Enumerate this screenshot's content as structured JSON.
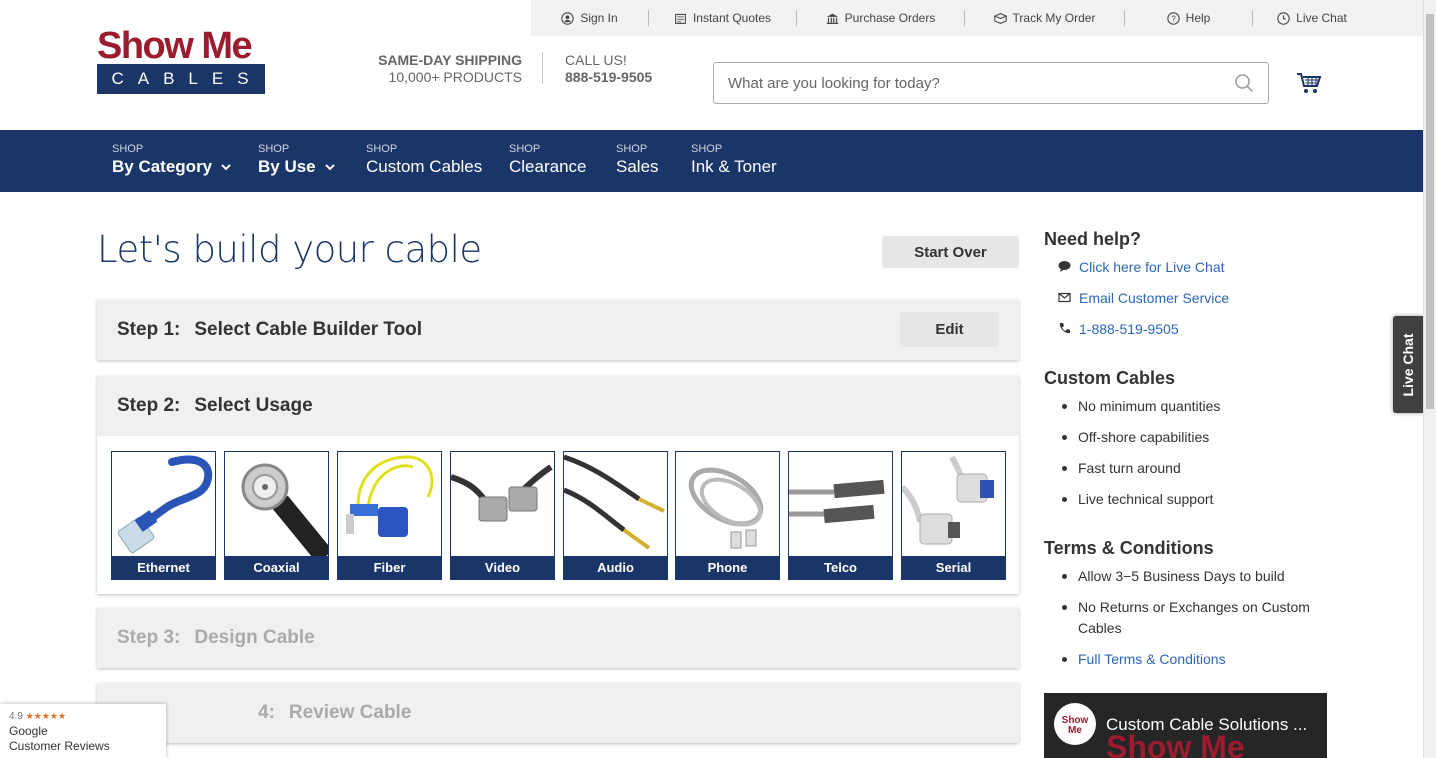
{
  "topbar": {
    "items": [
      {
        "label": "Sign In",
        "icon": "user-icon"
      },
      {
        "label": "Instant Quotes",
        "icon": "quote-icon"
      },
      {
        "label": "Purchase Orders",
        "icon": "bank-icon"
      },
      {
        "label": "Track My Order",
        "icon": "box-icon"
      },
      {
        "label": "Help",
        "icon": "help-icon"
      },
      {
        "label": "Live Chat",
        "icon": "clock-icon"
      }
    ]
  },
  "logo": {
    "line1": "Show Me",
    "line2": "CABLES"
  },
  "header": {
    "ship_bold": "SAME-DAY SHIPPING",
    "ship_sub": "10,000+ PRODUCTS",
    "call_label": "CALL US!",
    "call_number": "888-519-9505"
  },
  "search": {
    "placeholder": "What are you looking for today?"
  },
  "nav": {
    "items": [
      {
        "pre": "SHOP",
        "label": "By Category"
      },
      {
        "pre": "SHOP",
        "label": "By Use"
      },
      {
        "pre": "SHOP",
        "label": "Custom Cables"
      },
      {
        "pre": "SHOP",
        "label": "Clearance"
      },
      {
        "pre": "SHOP",
        "label": "Sales"
      },
      {
        "pre": "SHOP",
        "label": "Ink & Toner"
      }
    ]
  },
  "main": {
    "title": "Let's build your cable",
    "start_over": "Start Over",
    "steps": [
      {
        "num": "Step 1:",
        "label": "Select Cable Builder Tool",
        "action": "Edit"
      },
      {
        "num": "Step 2:",
        "label": "Select Usage"
      },
      {
        "num": "Step 3:",
        "label": "Design Cable"
      },
      {
        "num": "4:",
        "label": "Review Cable"
      }
    ],
    "usage_tiles": [
      "Ethernet",
      "Coaxial",
      "Fiber",
      "Video",
      "Audio",
      "Phone",
      "Telco",
      "Serial"
    ]
  },
  "sidebar": {
    "help_title": "Need help?",
    "help_links": [
      {
        "label": "Click here for Live Chat",
        "icon": "chat-icon"
      },
      {
        "label": "Email Customer Service",
        "icon": "mail-icon"
      },
      {
        "label": "1-888-519-9505",
        "icon": "phone-icon"
      }
    ],
    "custom_title": "Custom Cables",
    "custom_items": [
      "No minimum quantities",
      "Off-shore capabilities",
      "Fast turn around",
      "Live technical support"
    ],
    "terms_title": "Terms & Conditions",
    "terms_items": [
      "Allow 3−5 Business Days to build",
      "No Returns or Exchanges on Custom Cables"
    ],
    "terms_link": "Full Terms & Conditions",
    "video_title": "Custom Cable Solutions ...",
    "video_brand": "Show Me",
    "video_logo": "Show Me"
  },
  "live_chat_tab": "Live Chat",
  "google_review": {
    "rating": "4.9",
    "stars": "★★★★★",
    "source": "Google",
    "label": "Customer Reviews"
  },
  "colors": {
    "navy": "#1a3567",
    "brand_red": "#9b1c2e",
    "link": "#2c66b4"
  }
}
